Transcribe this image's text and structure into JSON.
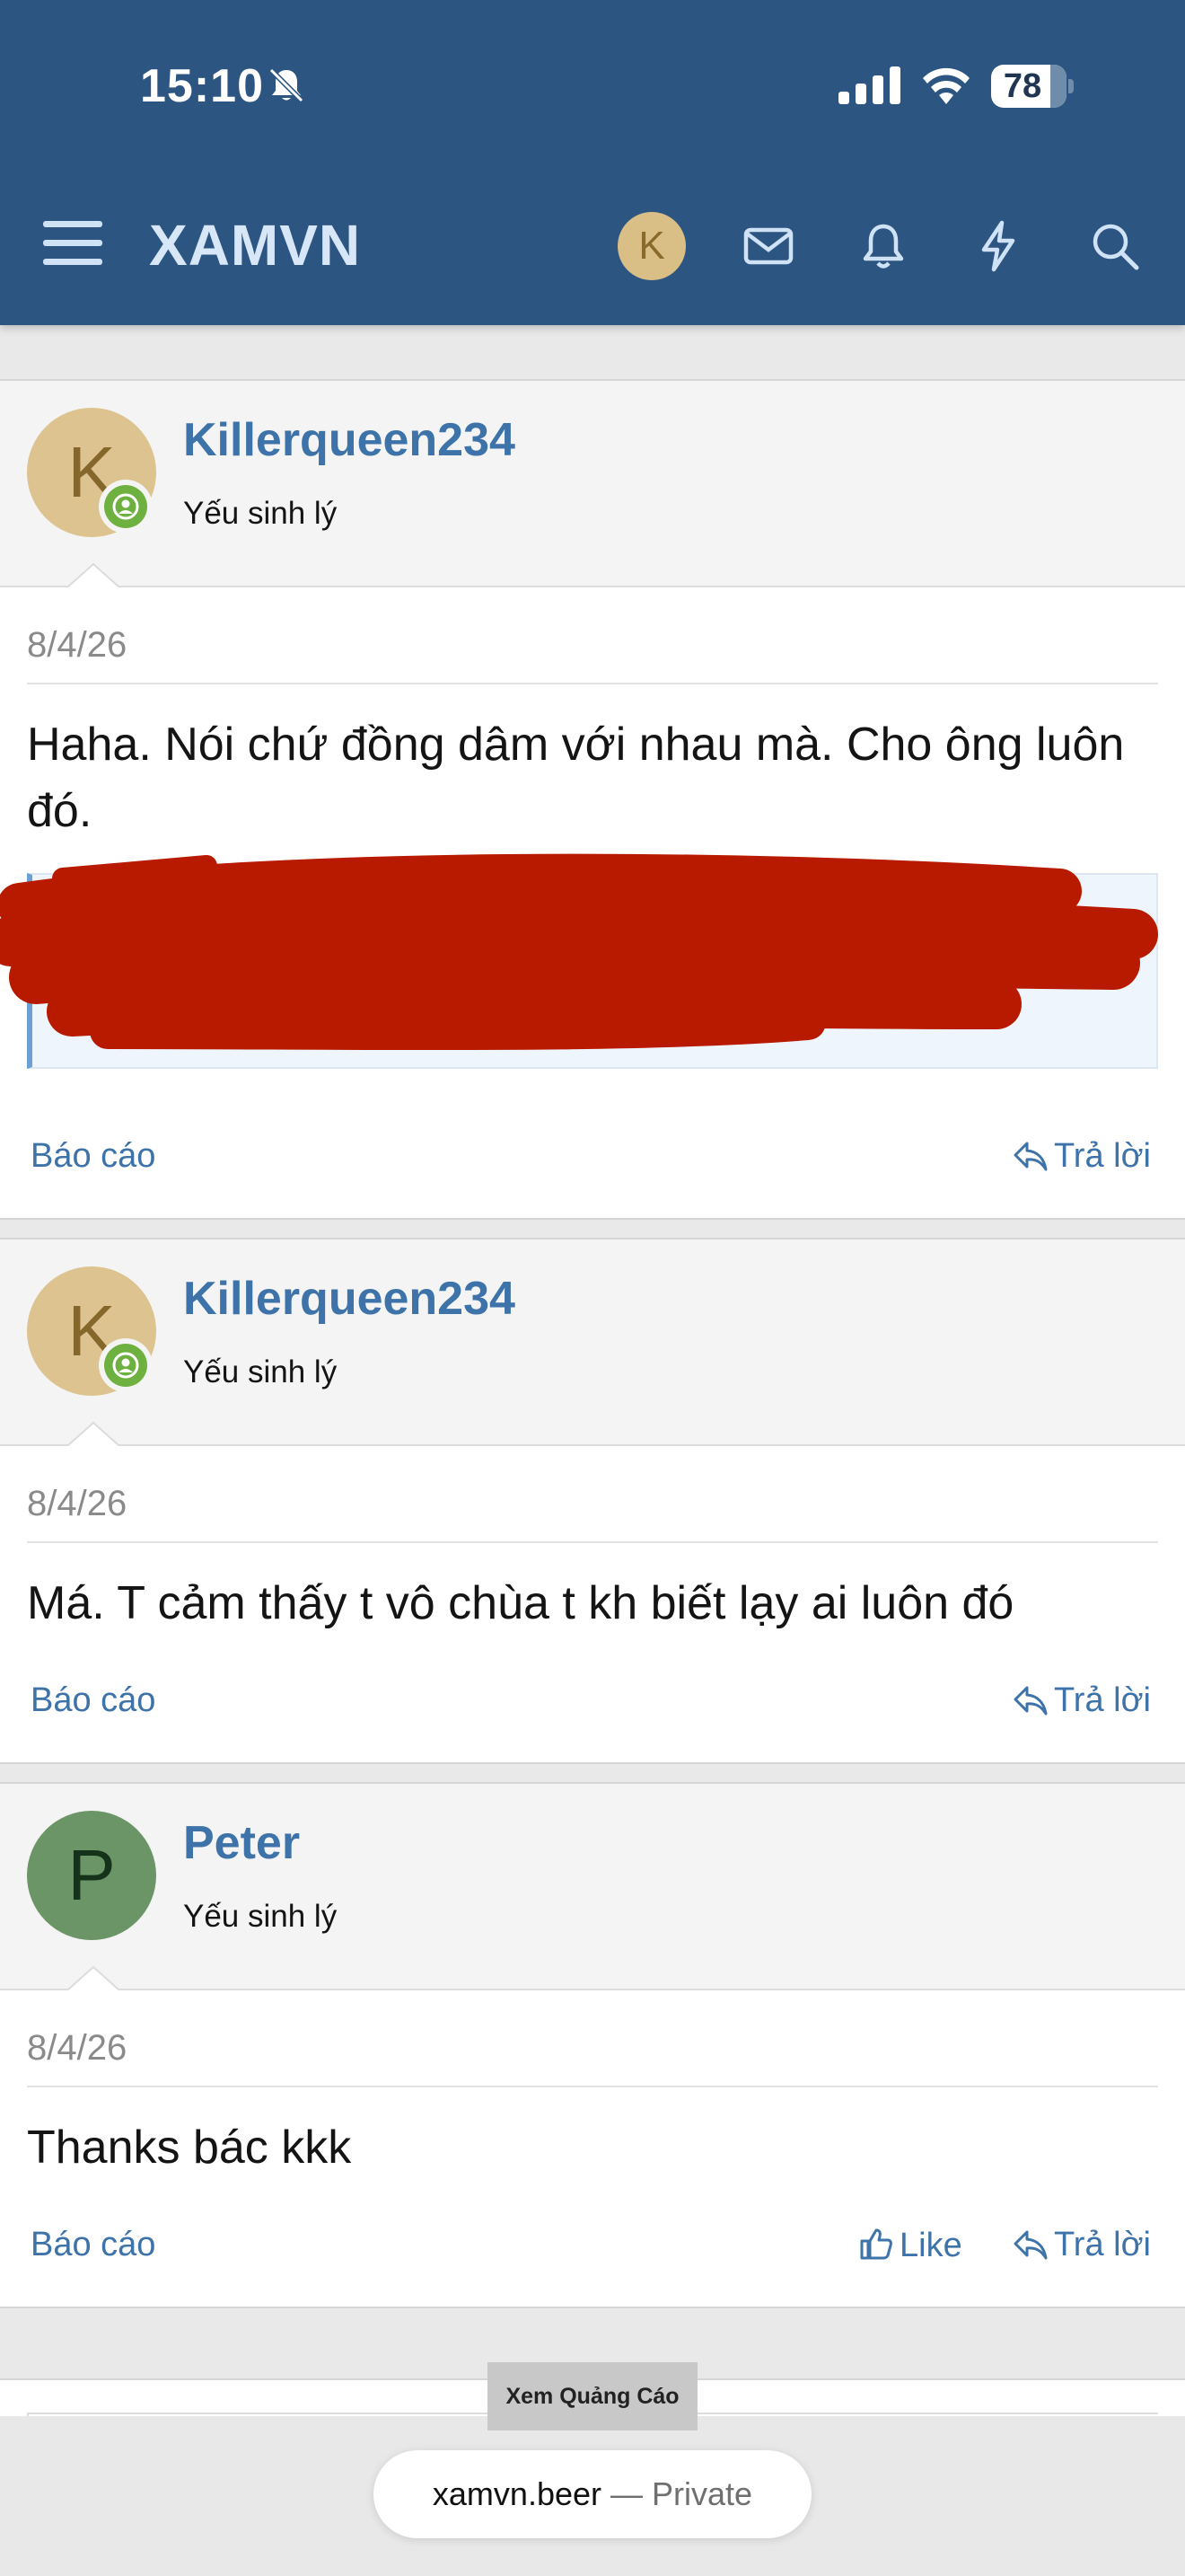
{
  "status_bar": {
    "time": "15:10",
    "battery": "78",
    "battery_level": 0.78,
    "icons": [
      "silent-mode-icon",
      "cellular-signal-icon",
      "wifi-icon",
      "battery-icon"
    ]
  },
  "header": {
    "title": "XAMVN",
    "avatar_letter": "K",
    "avatar_color": "#d9be86",
    "background_color": "#2d5582",
    "icons": [
      "menu-icon",
      "mail-icon",
      "bell-icon",
      "lightning-icon",
      "search-icon"
    ]
  },
  "posts": [
    {
      "username": "Killerqueen234",
      "avatar_letter": "K",
      "avatar_color": "#dcc38f",
      "user_title": "Yếu sinh lý",
      "online": true,
      "date": "8/4/26",
      "text": "Haha. Nói chứ đồng dâm với nhau mà. Cho ông luôn đó.",
      "has_redacted_quote": true,
      "actions": {
        "report": "Báo cáo",
        "reply": "Trả lời"
      }
    },
    {
      "username": "Killerqueen234",
      "avatar_letter": "K",
      "avatar_color": "#dcc38f",
      "user_title": "Yếu sinh lý",
      "online": true,
      "date": "8/4/26",
      "text": "Má. T cảm thấy t vô chùa t kh biết lạy ai luôn đó",
      "actions": {
        "report": "Báo cáo",
        "reply": "Trả lời"
      }
    },
    {
      "username": "Peter",
      "avatar_letter": "P",
      "avatar_color": "#6c9567",
      "user_title": "Yếu sinh lý",
      "online": false,
      "date": "8/4/26",
      "text": "Thanks bác kkk",
      "actions": {
        "report": "Báo cáo",
        "like": "Like",
        "reply": "Trả lời"
      }
    }
  ],
  "ad": {
    "label": "Xem Quảng Cáo"
  },
  "browser": {
    "domain": "xamvn.beer",
    "separator": "— ",
    "mode": "Private"
  },
  "colors": {
    "link": "#3d73a8",
    "online": "#6eb140",
    "redaction": "#b81a00"
  }
}
